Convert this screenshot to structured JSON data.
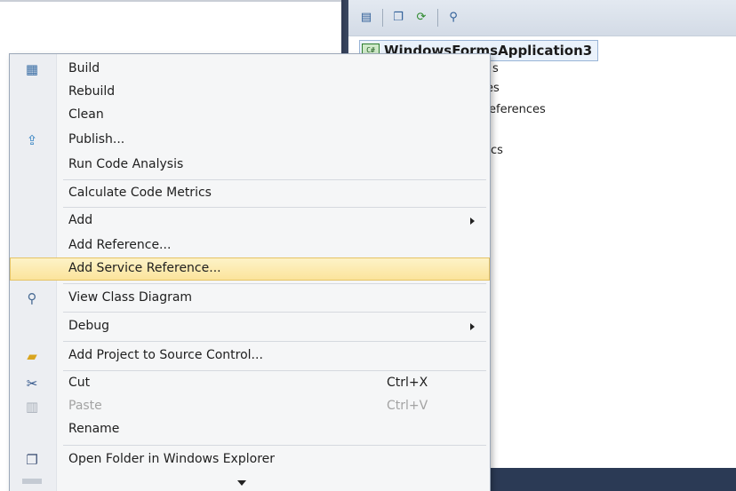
{
  "solution_explorer": {
    "project_name": "WindowsFormsApplication3",
    "tree_fragments": [
      "s",
      "es",
      "eferences",
      "cs"
    ],
    "toolbar_icons": [
      "properties-icon",
      "show-all-files-icon",
      "refresh-icon",
      "class-view-icon"
    ]
  },
  "context_menu": {
    "items": [
      {
        "label": "Build",
        "icon": "build-icon"
      },
      {
        "label": "Rebuild"
      },
      {
        "label": "Clean"
      },
      {
        "label": "Publish...",
        "icon": "publish-icon"
      },
      {
        "label": "Run Code Analysis"
      },
      {
        "label": "Calculate Code Metrics"
      },
      {
        "label": "Add",
        "submenu": true
      },
      {
        "label": "Add Reference..."
      },
      {
        "label": "Add Service Reference...",
        "highlighted": true
      },
      {
        "label": "View Class Diagram",
        "icon": "class-diagram-icon"
      },
      {
        "label": "Debug",
        "submenu": true
      },
      {
        "label": "Add Project to Source Control...",
        "icon": "folder-icon"
      },
      {
        "label": "Cut",
        "shortcut": "Ctrl+X",
        "icon": "scissors-icon"
      },
      {
        "label": "Paste",
        "shortcut": "Ctrl+V",
        "icon": "paste-icon",
        "disabled": true
      },
      {
        "label": "Rename"
      },
      {
        "label": "Open Folder in Windows Explorer",
        "icon": "open-folder-icon"
      }
    ]
  },
  "colors": {
    "highlight": "#fbe39a",
    "menu_background": "#f5f6f7",
    "status_bar": "#2b3a55"
  }
}
